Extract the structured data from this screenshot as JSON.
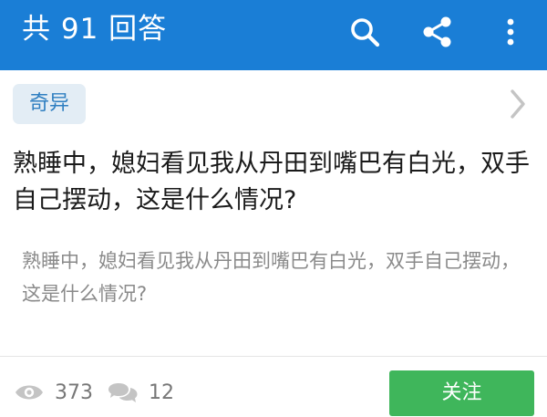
{
  "header": {
    "title": "共 91 回答",
    "background": "#1a7ed6",
    "icons": [
      "search-icon",
      "share-icon",
      "more-vertical-icon"
    ]
  },
  "topic": {
    "tag": "奇异",
    "tag_color": "#2f7fc1",
    "tag_background": "#e3edf5"
  },
  "question": {
    "title": "熟睡中，媳妇看见我从丹田到嘴巴有白光，双手自己摆动，这是什么情况?",
    "body": "熟睡中，媳妇看见我从丹田到嘴巴有白光，双手自己摆动，这是什么情况?"
  },
  "footer": {
    "views": "373",
    "answers": "12",
    "follow_label": "关注",
    "follow_color": "#3fb65b"
  }
}
